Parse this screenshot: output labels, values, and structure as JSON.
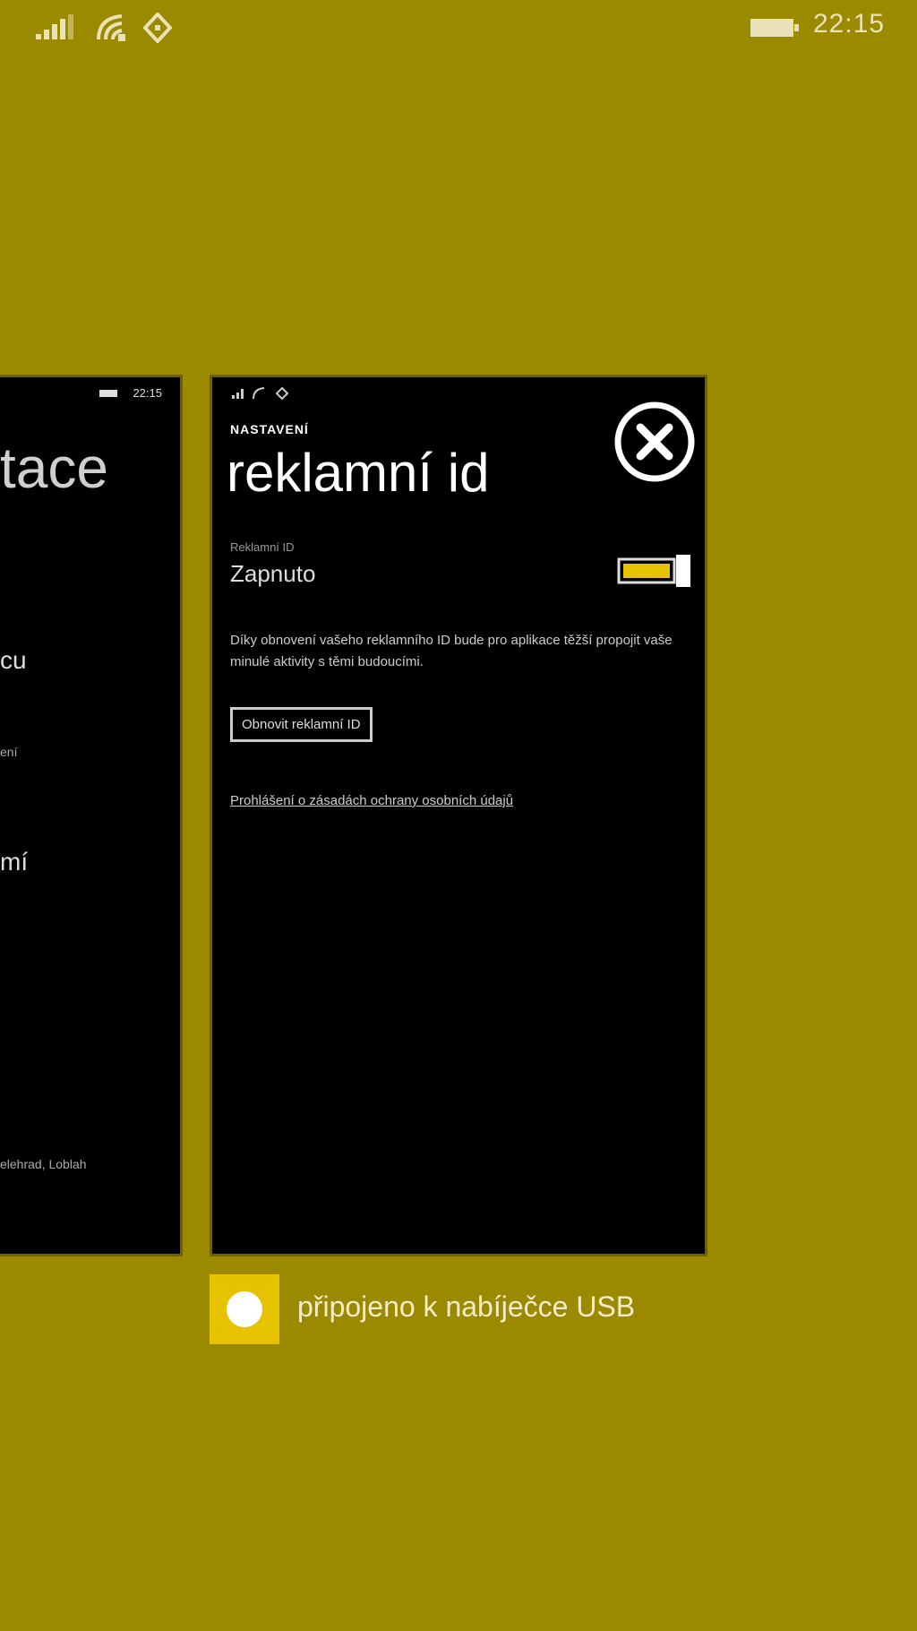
{
  "status_bar": {
    "time": "22:15",
    "icons": [
      "signal-icon",
      "wifi-icon",
      "data-icon",
      "battery-icon"
    ]
  },
  "left_card": {
    "status_time": "22:15",
    "title_fragment": "tace",
    "item1_fragment": "cu",
    "item2_fragment": "ení",
    "item3_fragment": "mí",
    "footer_fragment": "elehrad, Loblah"
  },
  "main_card": {
    "header": "NASTAVENÍ",
    "title": "reklamní id",
    "field_label": "Reklamní ID",
    "field_value": "Zapnuto",
    "toggle_on": true,
    "description": "Díky obnovení vašeho reklamního ID bude pro aplikace těžší propojit vaše minulé aktivity s těmi budoucími.",
    "button_label": "Obnovit reklamní ID",
    "link_label": "Prohlášení o zásadách ochrany osobních údajů"
  },
  "notification": {
    "text": "připojeno k nabíječce USB"
  },
  "colors": {
    "background": "#9b8a00",
    "accent": "#e6c200"
  }
}
